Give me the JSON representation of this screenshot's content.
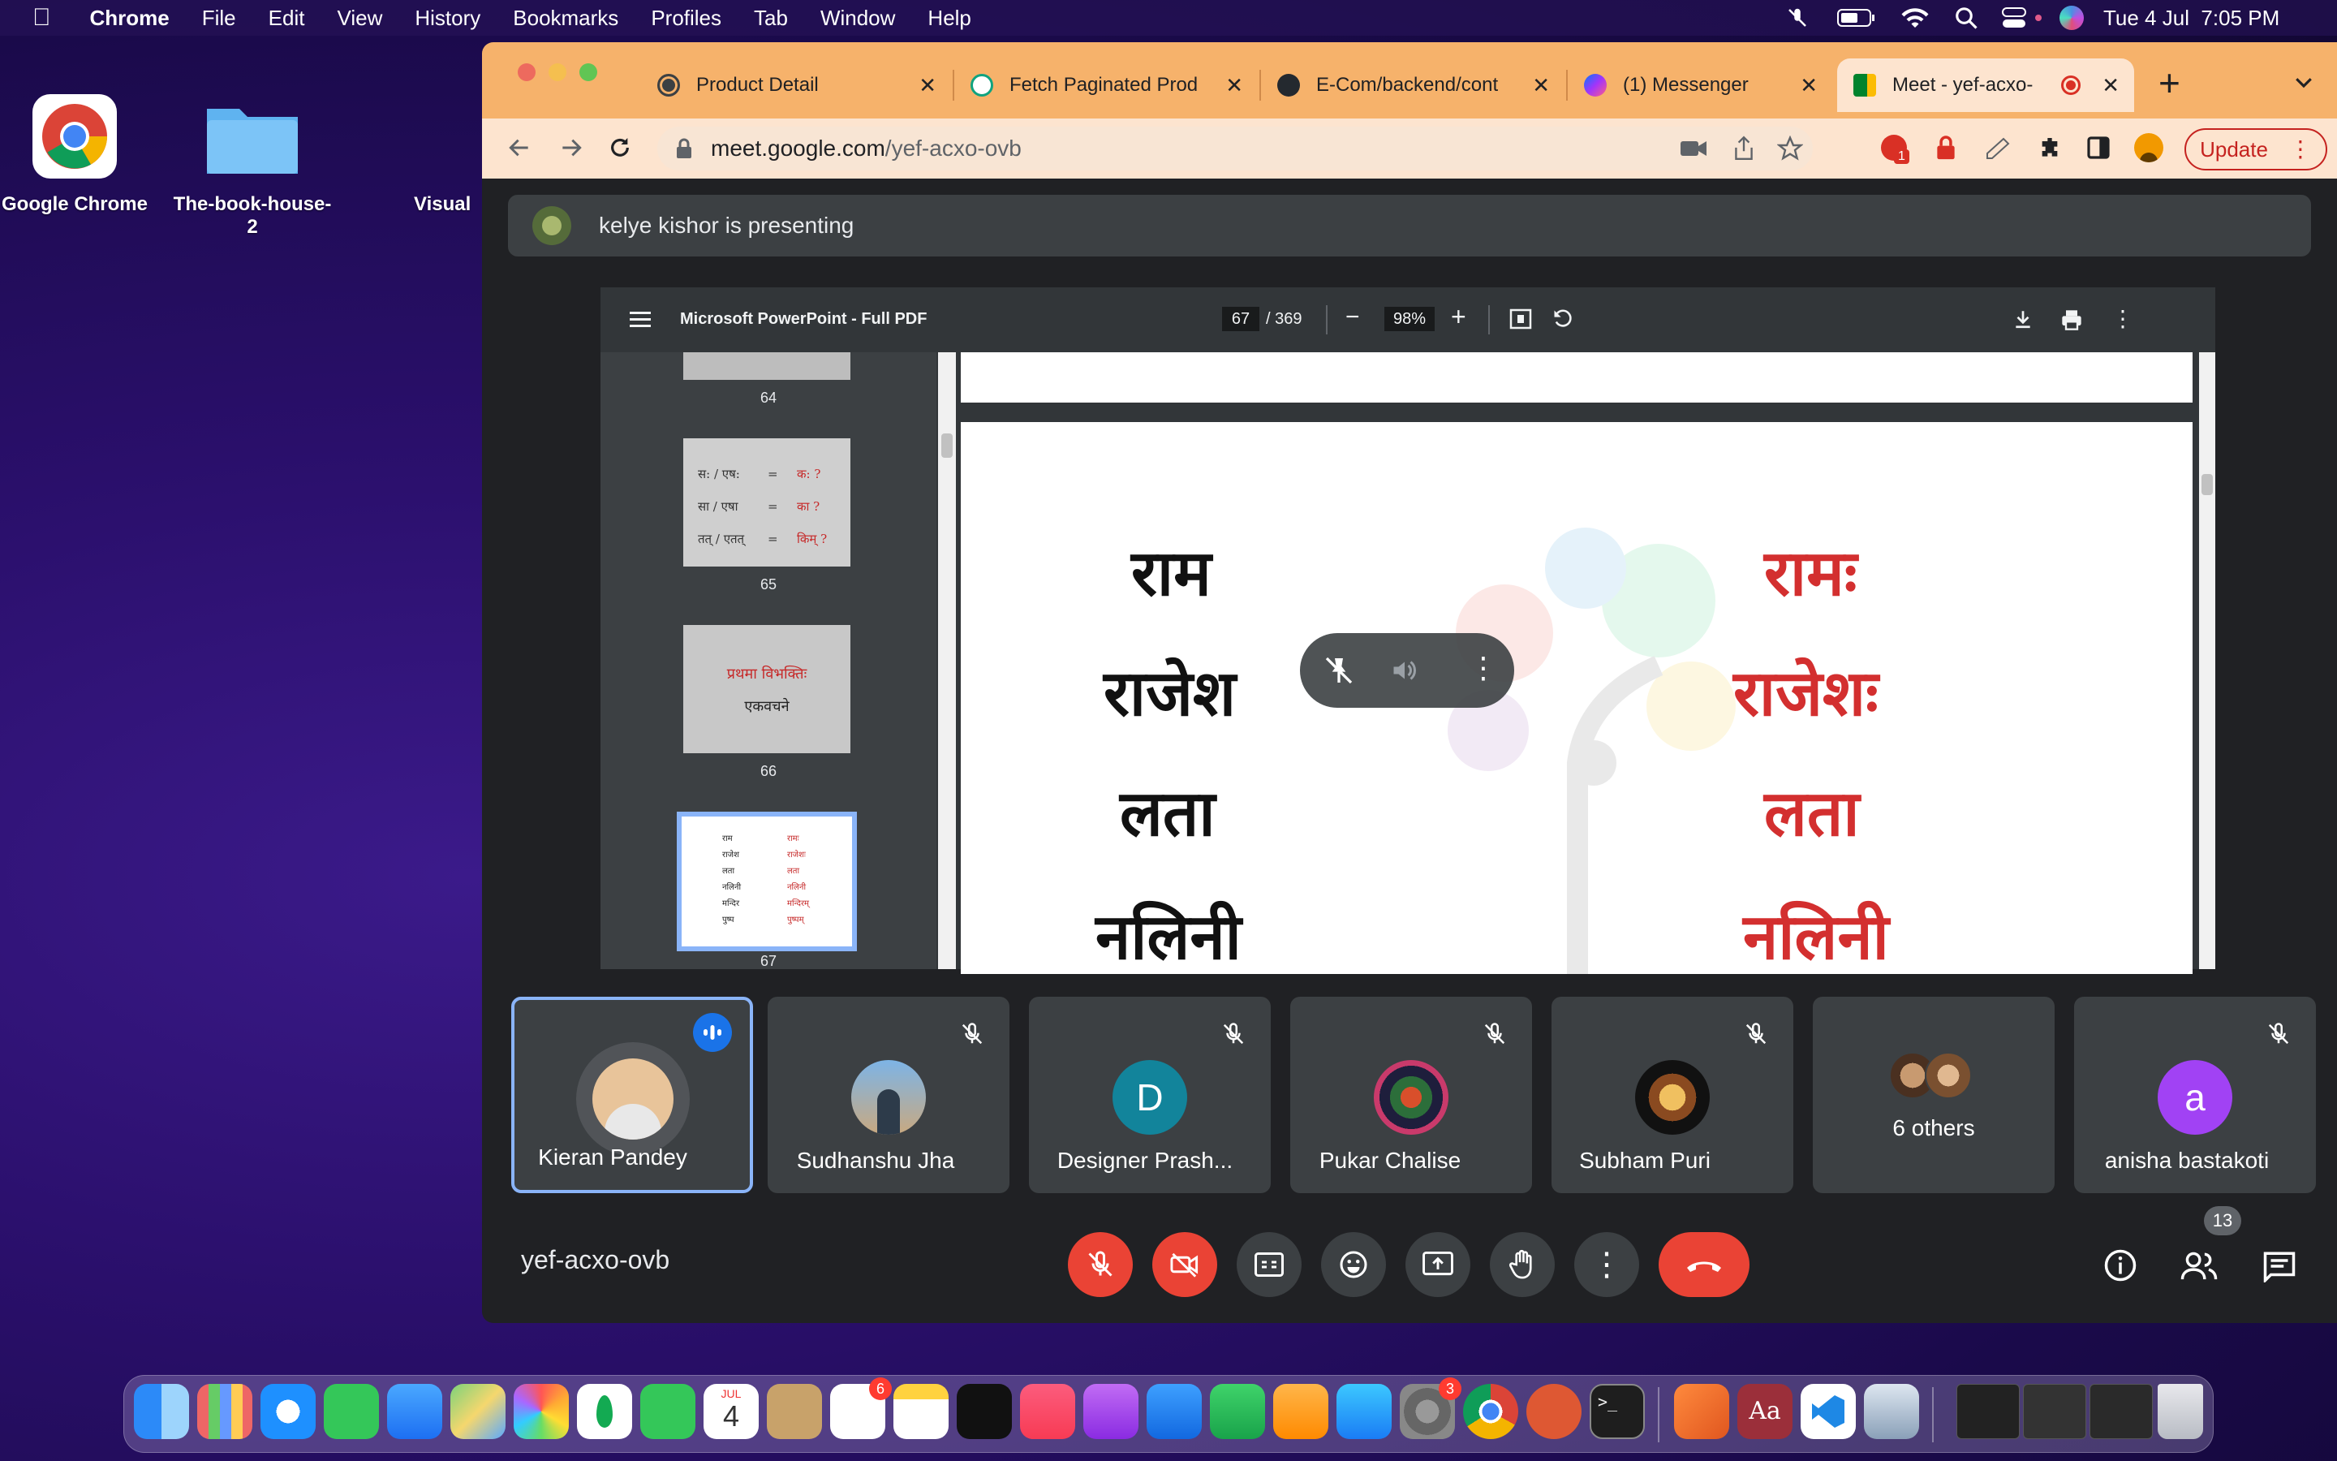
{
  "menubar": {
    "app": "Chrome",
    "items": [
      "File",
      "Edit",
      "View",
      "History",
      "Bookmarks",
      "Profiles",
      "Tab",
      "Window",
      "Help"
    ],
    "datetime": "Tue 4 Jul  7:05 PM"
  },
  "desktop": {
    "icons": [
      "Google Chrome",
      "The-book-house-2",
      "Visual"
    ]
  },
  "browser": {
    "tabs": [
      {
        "title": "Product Detail"
      },
      {
        "title": "Fetch Paginated Prod"
      },
      {
        "title": "E-Com/backend/cont"
      },
      {
        "title": "(1) Messenger"
      },
      {
        "title": "Meet - yef-acxo-"
      }
    ],
    "url_host": "meet.google.com",
    "url_path": "/yef-acxo-ovb",
    "update_label": "Update",
    "ext_badge": "1"
  },
  "meet": {
    "presenting_text": "kelye kishor is presenting",
    "pdf": {
      "title": "Microsoft PowerPoint - Full PDF",
      "page_current": "67",
      "page_total": "/ 369",
      "zoom": "98%",
      "thumbnails": [
        {
          "num": "64"
        },
        {
          "num": "65",
          "lines": [
            [
              "स: / एष:",
              "=",
              "क: ?"
            ],
            [
              "सा / एषा",
              "=",
              "का ?"
            ],
            [
              "तत् / एतत्",
              "=",
              "किम् ?"
            ]
          ]
        },
        {
          "num": "66",
          "line1": "प्रथमा विभक्तिः",
          "line2": "एकवचने"
        },
        {
          "num": "67"
        }
      ],
      "slide_words_left": [
        "राम",
        "राजेश",
        "लता",
        "नलिनी"
      ],
      "slide_words_right": [
        "रामः",
        "राजेशः",
        "लता",
        "नलिनी"
      ],
      "thumb67_left": [
        "राम",
        "राजेश",
        "लता",
        "नलिनी",
        "मन्दिर",
        "पुष्प"
      ],
      "thumb67_right": [
        "रामः",
        "राजेशः",
        "लता",
        "नलिनी",
        "मन्दिरम्",
        "पुष्पम्"
      ]
    },
    "participants": [
      {
        "name": "Kieran Pandey",
        "speaking": true
      },
      {
        "name": "Sudhanshu Jha"
      },
      {
        "name": "Designer Prash...",
        "initial": "D"
      },
      {
        "name": "Pukar Chalise"
      },
      {
        "name": "Subham Puri"
      },
      {
        "name": "6 others"
      },
      {
        "name": "anisha bastakoti",
        "initial": "a"
      }
    ],
    "meeting_code": "yef-acxo-ovb",
    "people_count": "13"
  },
  "dock": {
    "calendar_month": "JUL",
    "calendar_day": "4",
    "reminders_badge": "6",
    "settings_badge": "3"
  },
  "colors": {
    "tabbar": "#f6b26b",
    "red": "#ea4335",
    "accent_blue": "#8ab4f8"
  }
}
